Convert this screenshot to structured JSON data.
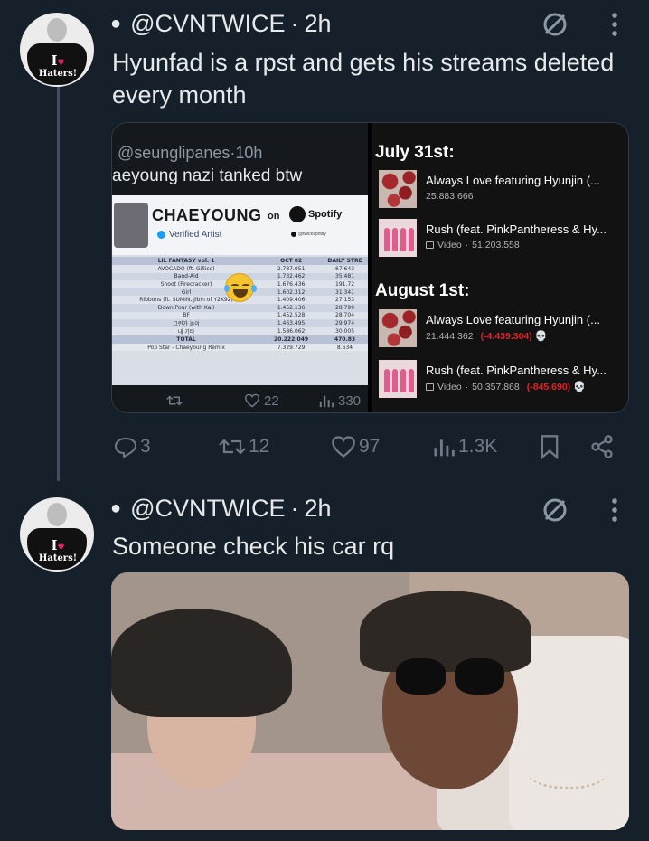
{
  "colors": {
    "background": "#15202b",
    "text_primary": "#e7e9ea",
    "text_secondary": "#6e7a86",
    "loss_red": "#e0202a"
  },
  "posts": [
    {
      "avatar_text_top": "I",
      "avatar_text_bottom": "Haters!",
      "handle": "@CVNTWICE",
      "separator": "·",
      "time": "2h",
      "text": "Hyunfad is a rpst and gets his streams deleted every month",
      "media": {
        "left": {
          "handle": "@seunglipanes",
          "separator": "·",
          "time": "10h",
          "quote_text": "aeyoung nazi tanked btw",
          "artist": "CHAEYOUNG",
          "on_label": "on",
          "platform": "Spotify",
          "verified_label": "Verified Artist",
          "tiny_handle": "@twicespotify",
          "table": {
            "headers": [
              "LIL FANTASY vol. 1",
              "OCT 02",
              "DAILY STRE"
            ],
            "rows": [
              [
                "AVOCADO (ft. Gillico)",
                "2.787.051",
                "67.643"
              ],
              [
                "Band-Aid",
                "1.732.462",
                "35.481"
              ],
              [
                "Shoot (Firecracker)",
                "1.676.436",
                "191.72"
              ],
              [
                "Girl",
                "1.602.312",
                "31.341"
              ],
              [
                "Ribbons (ft. SUMIN, Jibin of Y2K92)",
                "1.409.406",
                "27.153"
              ],
              [
                "Down Pour (with Kai)",
                "1.452.136",
                "28.799"
              ],
              [
                "BF",
                "1.452.528",
                "28.704"
              ],
              [
                "그런가 놀이",
                "1.463.495",
                "29.974"
              ],
              [
                "내 기타",
                "1.586.062",
                "30.005"
              ],
              [
                "TOTAL",
                "20.222.049",
                "470.83"
              ],
              [
                "Pop Star - Chaeyoung Remix",
                "7.329.729",
                "8.634"
              ]
            ]
          },
          "stats": {
            "retweets": "",
            "likes": "22",
            "views": "330"
          }
        },
        "right": {
          "sections": [
            {
              "date": "July 31st:",
              "tracks": [
                {
                  "cover": "love",
                  "title": "Always Love featuring Hyunjin (...",
                  "video_label": "",
                  "plays": "25.883.666",
                  "loss": "",
                  "skull": ""
                },
                {
                  "cover": "rush",
                  "title": "Rush (feat. PinkPantheress & Hy...",
                  "video_label": "Video",
                  "sep": "·",
                  "plays": "51.203.558",
                  "loss": "",
                  "skull": ""
                }
              ]
            },
            {
              "date": "August 1st:",
              "tracks": [
                {
                  "cover": "love",
                  "title": "Always Love featuring Hyunjin (...",
                  "video_label": "",
                  "plays": "21.444.362",
                  "loss": "(-4.439.304)",
                  "skull": "💀"
                },
                {
                  "cover": "rush",
                  "title": "Rush (feat. PinkPantheress & Hy...",
                  "video_label": "Video",
                  "sep": "·",
                  "plays": "50.357.868",
                  "loss": "(-845.690)",
                  "skull": "💀"
                }
              ]
            }
          ]
        }
      },
      "actions": {
        "replies": "3",
        "reposts": "12",
        "likes": "97",
        "views": "1.3K"
      }
    },
    {
      "avatar_text_top": "I",
      "avatar_text_bottom": "Haters!",
      "handle": "@CVNTWICE",
      "separator": "·",
      "time": "2h",
      "text": "Someone check his car rq"
    }
  ],
  "icons": [
    "blocked-circle-icon",
    "more-vertical-icon",
    "reply-icon",
    "repost-icon",
    "like-icon",
    "views-icon",
    "bookmark-icon",
    "share-icon"
  ]
}
